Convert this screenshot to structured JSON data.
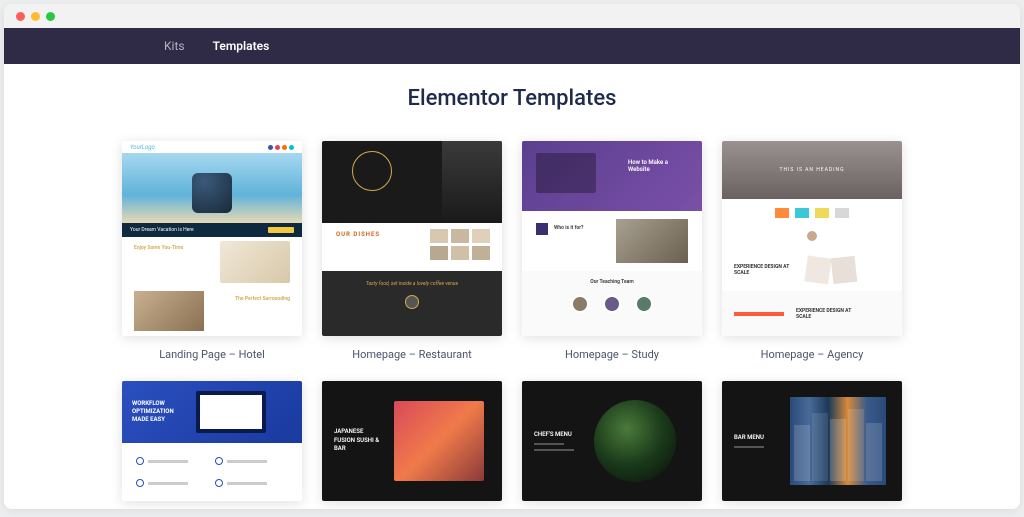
{
  "nav": {
    "kits": "Kits",
    "templates": "Templates"
  },
  "page_title": "Elementor Templates",
  "cards": [
    {
      "label": "Landing Page – Hotel"
    },
    {
      "label": "Homepage – Restaurant"
    },
    {
      "label": "Homepage – Study"
    },
    {
      "label": "Homepage – Agency"
    },
    {
      "label": ""
    },
    {
      "label": ""
    },
    {
      "label": ""
    },
    {
      "label": ""
    }
  ],
  "thumbs": {
    "hotel": {
      "logo": "YourLogo",
      "banner": "Your Dream Vacation is Here",
      "h1": "Enjoy Some You-Time",
      "h2": "The Perfect Surrounding"
    },
    "restaurant": {
      "section": "OUR DISHES",
      "tagline": "Tasty food, set inside a lovely coffee venue"
    },
    "study": {
      "hero": "How to Make a Website",
      "sub": "Who is it for?",
      "team": "Our Teaching Team"
    },
    "agency": {
      "hero": "THIS IS AN HEADING",
      "s1": "EXPERIENCE DESIGN AT SCALE",
      "s2": "EXPERIENCE DESIGN AT SCALE"
    },
    "workflow": {
      "h": "WORKFLOW OPTIMIZATION MADE EASY"
    },
    "sushi": {
      "h": "JAPANESE FUSION SUSHI & BAR"
    },
    "chef": {
      "h": "CHEF'S MENU"
    },
    "bar": {
      "h": "BAR MENU"
    }
  }
}
